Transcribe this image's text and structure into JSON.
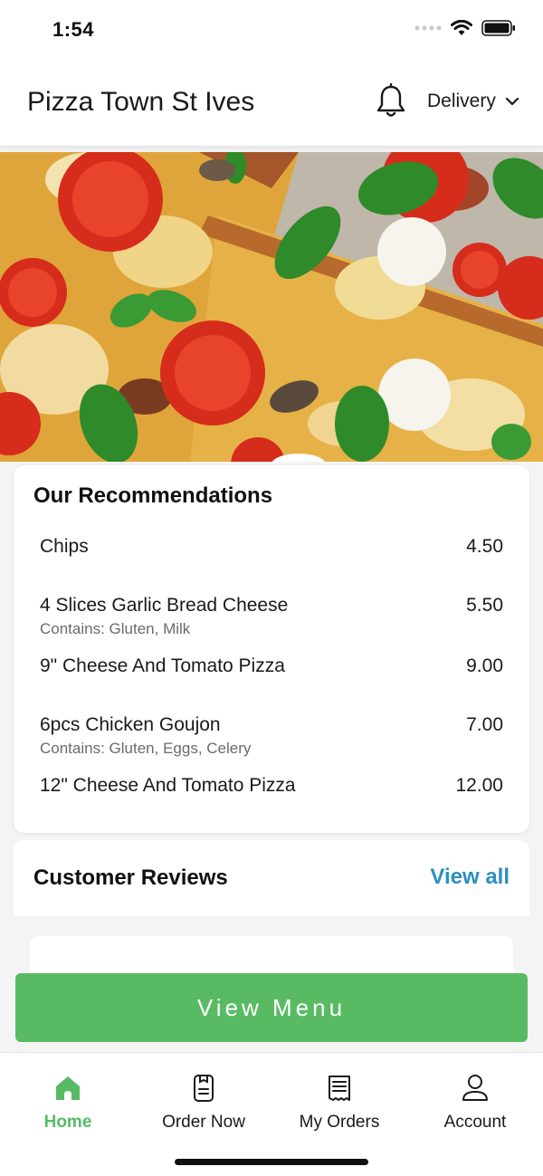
{
  "status_bar": {
    "time": "1:54"
  },
  "header": {
    "store_name": "Pizza Town St Ives",
    "order_mode": "Delivery"
  },
  "recommendations": {
    "title": "Our Recommendations",
    "items": [
      {
        "name": "Chips",
        "price": "4.50",
        "allergens": ""
      },
      {
        "name": "4 Slices Garlic Bread Cheese",
        "price": "5.50",
        "allergens": "Contains: Gluten, Milk"
      },
      {
        "name": "9\" Cheese And Tomato Pizza",
        "price": "9.00",
        "allergens": ""
      },
      {
        "name": "6pcs Chicken Goujon",
        "price": "7.00",
        "allergens": "Contains: Gluten, Eggs, Celery"
      },
      {
        "name": "12\" Cheese And Tomato Pizza",
        "price": "12.00",
        "allergens": ""
      }
    ]
  },
  "reviews": {
    "title": "Customer Reviews",
    "view_all_label": "View all"
  },
  "view_menu_label": "View Menu",
  "bottom_nav": {
    "items": [
      {
        "label": "Home",
        "icon": "home-icon",
        "active": true
      },
      {
        "label": "Order Now",
        "icon": "order-icon",
        "active": false
      },
      {
        "label": "My Orders",
        "icon": "receipt-icon",
        "active": false
      },
      {
        "label": "Account",
        "icon": "account-icon",
        "active": false
      }
    ]
  },
  "colors": {
    "accent_green": "#58bb63",
    "link_blue": "#2b8fc1"
  }
}
